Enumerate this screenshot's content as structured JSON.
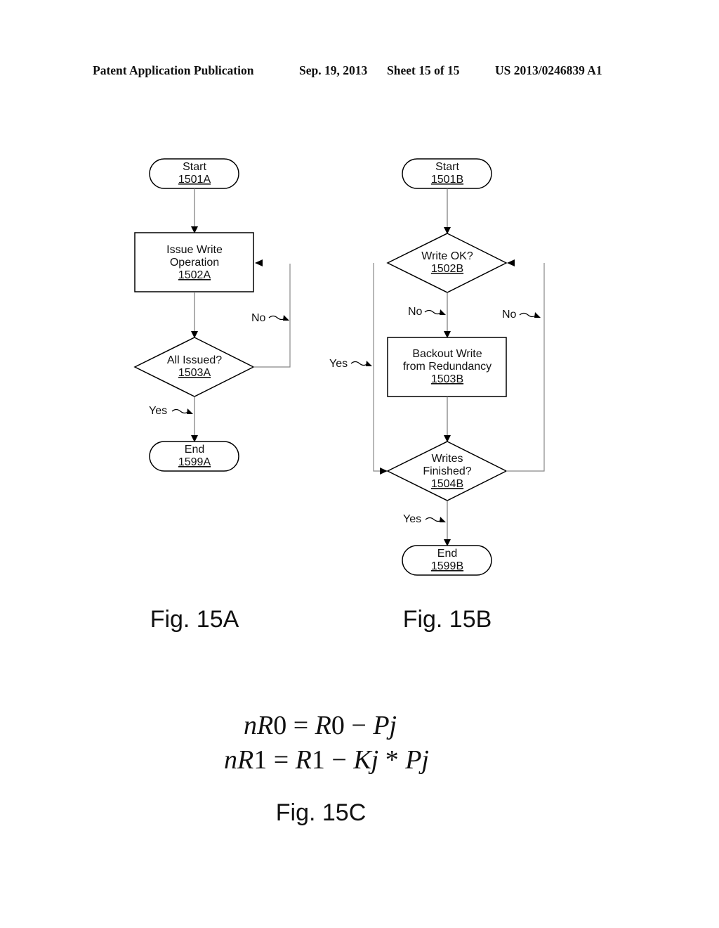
{
  "header": {
    "publication": "Patent Application Publication",
    "date": "Sep. 19, 2013",
    "sheet": "Sheet 15 of 15",
    "number": "US 2013/0246839 A1"
  },
  "fig15a": {
    "label": "Fig. 15A",
    "start": {
      "text": "Start",
      "ref": "1501A"
    },
    "step": {
      "line1": "Issue Write",
      "line2": "Operation",
      "ref": "1502A"
    },
    "decision": {
      "text": "All Issued?",
      "ref": "1503A"
    },
    "end": {
      "text": "End",
      "ref": "1599A"
    },
    "no_label": "No",
    "yes_label": "Yes"
  },
  "fig15b": {
    "label": "Fig. 15B",
    "start": {
      "text": "Start",
      "ref": "1501B"
    },
    "decision1": {
      "text": "Write OK?",
      "ref": "1502B"
    },
    "step": {
      "line1": "Backout Write",
      "line2": "from Redundancy",
      "ref": "1503B"
    },
    "decision2": {
      "line1": "Writes",
      "line2": "Finished?",
      "ref": "1504B"
    },
    "end": {
      "text": "End",
      "ref": "1599B"
    },
    "no_label_1": "No",
    "no_label_2": "No",
    "yes_label_1": "Yes",
    "yes_label_2": "Yes"
  },
  "fig15c": {
    "label": "Fig. 15C",
    "eq1": {
      "lhs_n": "n",
      "lhs_r": "R",
      "lhs_idx": "0",
      "eq": " = ",
      "r": "R",
      "r_idx": "0",
      "minus": " − ",
      "p": "Pj"
    },
    "eq2": {
      "lhs_n": "n",
      "lhs_r": "R",
      "lhs_idx": "1",
      "eq": " = ",
      "r": "R",
      "r_idx": "1",
      "minus": " − ",
      "k": "Kj",
      "times": " * ",
      "p": "Pj"
    }
  }
}
